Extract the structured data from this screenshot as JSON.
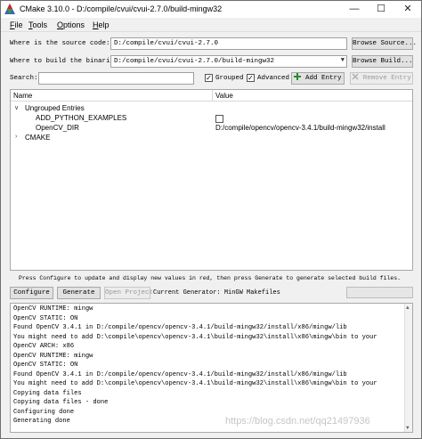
{
  "window": {
    "title": "CMake 3.10.0 - D:/compile/cvui/cvui-2.7.0/build-mingw32",
    "min_glyph": "—",
    "max_glyph": "☐",
    "close_glyph": "✕"
  },
  "menu": {
    "file_first": "F",
    "file_rest": "ile",
    "tools_first": "T",
    "tools_rest": "ools",
    "options_first": "O",
    "options_rest": "ptions",
    "help_first": "H",
    "help_rest": "elp"
  },
  "source": {
    "label": "Where is the source code:",
    "value": "D:/compile/cvui/cvui-2.7.0",
    "browse_label": "Browse Source..."
  },
  "build": {
    "label": "Where to build the binaries:",
    "value": "D:/compile/cvui/cvui-2.7.0/build-mingw32",
    "browse_label": "Browse Build..."
  },
  "search": {
    "label": "Search:",
    "value": "",
    "grouped_label": "Grouped",
    "grouped_checked": true,
    "advanced_label": "Advanced",
    "advanced_checked": true,
    "add_entry_label": "Add Entry",
    "remove_entry_label": "Remove Entry",
    "check_glyph": "✓"
  },
  "table": {
    "headers": {
      "name": "Name",
      "value": "Value"
    },
    "rows": [
      {
        "name": "Ungrouped Entries",
        "value": ""
      },
      {
        "name": "ADD_PYTHON_EXAMPLES",
        "value": ""
      },
      {
        "name": "OpenCV_DIR",
        "value": "D:/compile/opencv/opencv-3.4.1/build-mingw32/install"
      },
      {
        "name": "CMAKE",
        "value": ""
      }
    ],
    "expanded_glyph": "∨",
    "collapsed_glyph": "›",
    "add_python_checked": false
  },
  "hint": "Press Configure to update and display new values in red, then press Generate to generate selected build files.",
  "actions": {
    "configure_label": "Configure",
    "generate_label": "Generate",
    "open_project_label": "Open Project",
    "current_generator": "Current Generator: MinGW Makefiles"
  },
  "log": [
    "OpenCV RUNTIME: mingw",
    "OpenCV STATIC: ON",
    "Found OpenCV 3.4.1 in D:/compile/opencv/opencv-3.4.1/build-mingw32/install/x86/mingw/lib",
    "You might need to add D:\\compile\\opencv\\opencv-3.4.1\\build-mingw32\\install\\x86\\mingw\\bin to your",
    "OpenCV ARCH: x86",
    "OpenCV RUNTIME: mingw",
    "OpenCV STATIC: ON",
    "Found OpenCV 3.4.1 in D:/compile/opencv/opencv-3.4.1/build-mingw32/install/x86/mingw/lib",
    "You might need to add D:\\compile\\opencv\\opencv-3.4.1\\build-mingw32\\install\\x86\\mingw\\bin to your",
    "Copying data files",
    "Copying data files - done",
    "Configuring done",
    "Generating done"
  ],
  "watermark": "https://blog.csdn.net/qq21497936",
  "scroll": {
    "up_glyph": "▲",
    "down_glyph": "▼"
  },
  "colors": {
    "cmake_red": "#d42027",
    "cmake_blue": "#3a66b3",
    "cmake_green": "#3c9a3c"
  }
}
